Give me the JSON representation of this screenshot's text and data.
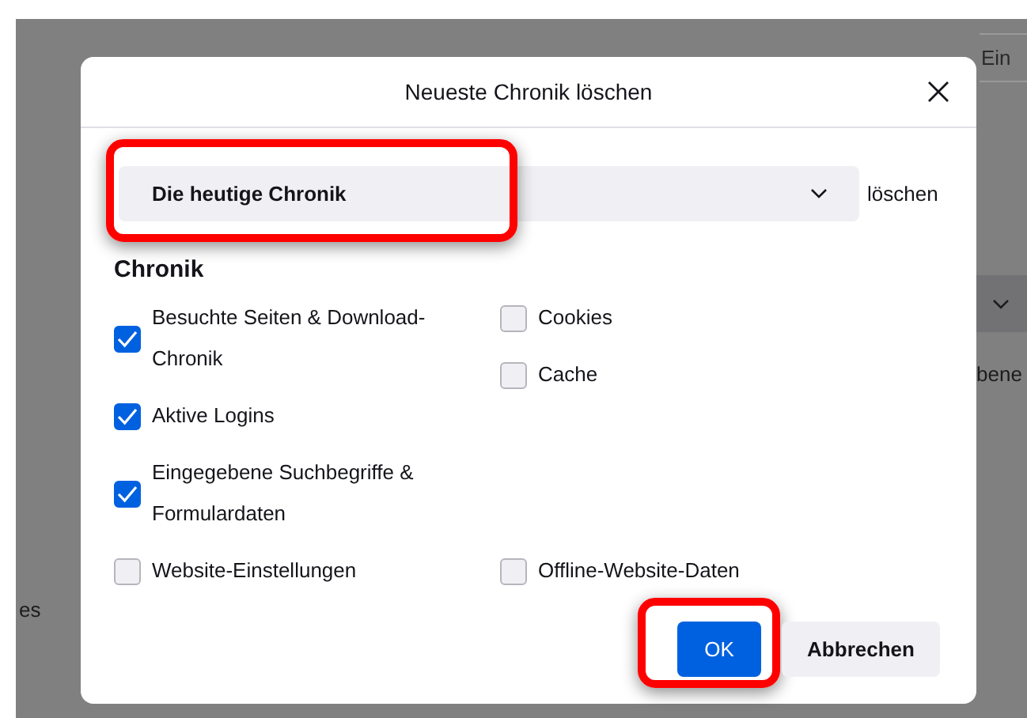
{
  "background": {
    "search_field": {
      "value": "Ein"
    },
    "fragments": [
      {
        "kind": "right",
        "text": "bene"
      },
      {
        "kind": "left",
        "text": "es"
      }
    ]
  },
  "dialog": {
    "title": "Neueste Chronik löschen",
    "period": {
      "value": "Die heutige Chronik",
      "suffix": "löschen",
      "highlighted": true
    },
    "section_heading": "Chronik",
    "left_column": [
      {
        "label": "Besuchte Seiten & Download-Chronik",
        "checked": true
      },
      {
        "label": "Aktive Logins",
        "checked": true
      },
      {
        "label": "Eingegebene Suchbegriffe & Formulardaten",
        "checked": true
      },
      {
        "label": "Website-Einstellungen",
        "checked": false
      }
    ],
    "right_column": [
      {
        "label": "Cookies",
        "checked": false
      },
      {
        "label": "Cache",
        "checked": false
      },
      {
        "label": "Offline-Website-Daten",
        "checked": false
      }
    ],
    "buttons": [
      {
        "kind": "primary",
        "label": "OK",
        "highlighted": true
      },
      {
        "kind": "secondary",
        "label": "Abbrechen",
        "highlighted": false
      }
    ]
  }
}
